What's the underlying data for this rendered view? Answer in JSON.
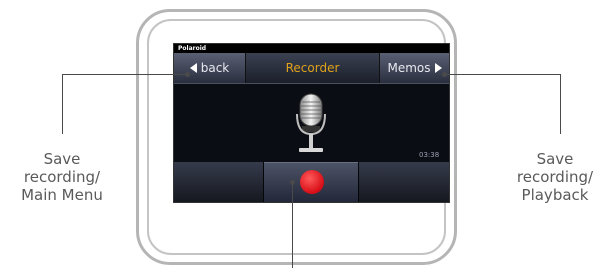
{
  "device": {
    "brand": "Polaroid",
    "nav": {
      "back_label": "back",
      "title": "Recorder",
      "memos_label": "Memos"
    },
    "timer": "03:38",
    "record_button": {
      "color": "#e0141c"
    }
  },
  "callouts": {
    "left": "Save recording/ Main Menu",
    "right": "Save recording/ Playback"
  },
  "colors": {
    "title": "#e0a21a",
    "record": "#e0141c"
  },
  "icons": [
    "microphone-icon",
    "left-arrow-icon",
    "right-arrow-icon",
    "record-icon"
  ]
}
